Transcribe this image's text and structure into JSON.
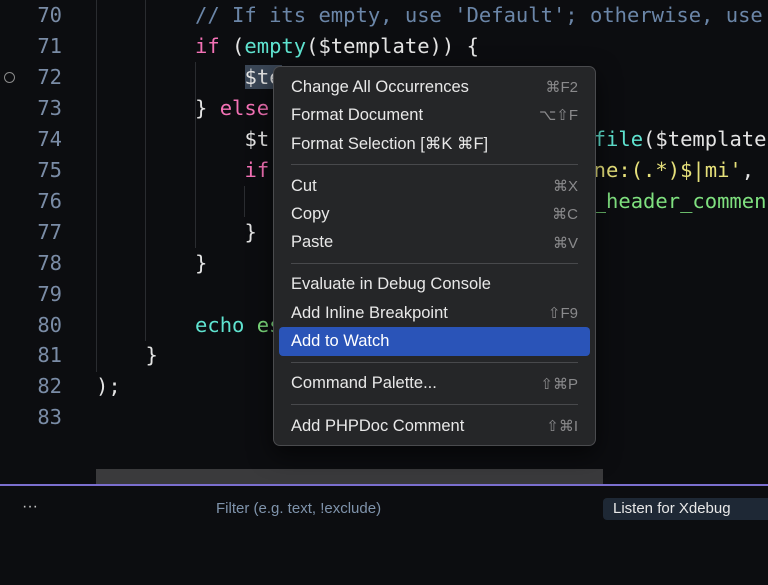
{
  "editor": {
    "lines": [
      {
        "n": "70",
        "indent": 8,
        "segs": [
          {
            "t": "// If its empty, use 'Default'; otherwise, use",
            "c": "comment"
          }
        ]
      },
      {
        "n": "71",
        "indent": 8,
        "segs": [
          {
            "t": "if",
            "c": "kw"
          },
          {
            "t": " (",
            "c": "var"
          },
          {
            "t": "empty",
            "c": "fn"
          },
          {
            "t": "($template)) {",
            "c": "var"
          }
        ]
      },
      {
        "n": "72",
        "indent": 12,
        "breakpoint": true,
        "segs": [
          {
            "t": "$te",
            "c": "var",
            "sel": true
          }
        ]
      },
      {
        "n": "73",
        "indent": 8,
        "segs": [
          {
            "t": "} ",
            "c": "var"
          },
          {
            "t": "else",
            "c": "kw"
          }
        ]
      },
      {
        "n": "74",
        "indent": 12,
        "segs": [
          {
            "t": "$t",
            "c": "var"
          }
        ],
        "right": [
          {
            "t": "file",
            "c": "fn"
          },
          {
            "t": "($template)",
            "c": "var"
          }
        ]
      },
      {
        "n": "75",
        "indent": 12,
        "segs": [
          {
            "t": "if",
            "c": "kw"
          }
        ],
        "right": [
          {
            "t": "ne:(.*)$|mi'",
            "c": "str"
          },
          {
            "t": ", $",
            "c": "var"
          }
        ]
      },
      {
        "n": "76",
        "indent": 16,
        "segs": [],
        "right": [
          {
            "t": "_header_commen",
            "c": "grn"
          }
        ]
      },
      {
        "n": "77",
        "indent": 12,
        "segs": [
          {
            "t": "}",
            "c": "var"
          }
        ]
      },
      {
        "n": "78",
        "indent": 8,
        "segs": [
          {
            "t": "}",
            "c": "var"
          }
        ]
      },
      {
        "n": "79",
        "indent": 0,
        "segs": []
      },
      {
        "n": "80",
        "indent": 8,
        "segs": [
          {
            "t": "echo",
            "c": "fn"
          },
          {
            "t": " es",
            "c": "grn"
          }
        ]
      },
      {
        "n": "81",
        "indent": 4,
        "segs": [
          {
            "t": "}",
            "c": "var"
          }
        ]
      },
      {
        "n": "82",
        "indent": 0,
        "segs": [
          {
            "t": ");",
            "c": "var"
          }
        ]
      },
      {
        "n": "83",
        "indent": 0,
        "segs": []
      }
    ]
  },
  "context_menu": {
    "groups": [
      [
        {
          "label": "Change All Occurrences",
          "key": "⌘F2"
        },
        {
          "label": "Format Document",
          "key": "⌥⇧F"
        },
        {
          "label": "Format Selection [⌘K ⌘F]",
          "key": ""
        }
      ],
      [
        {
          "label": "Cut",
          "key": "⌘X"
        },
        {
          "label": "Copy",
          "key": "⌘C"
        },
        {
          "label": "Paste",
          "key": "⌘V"
        }
      ],
      [
        {
          "label": "Evaluate in Debug Console",
          "key": ""
        },
        {
          "label": "Add Inline Breakpoint",
          "key": "⇧F9"
        },
        {
          "label": "Add to Watch",
          "key": "",
          "active": true
        }
      ],
      [
        {
          "label": "Command Palette...",
          "key": "⇧⌘P"
        }
      ],
      [
        {
          "label": "Add PHPDoc Comment",
          "key": "⇧⌘I"
        }
      ]
    ]
  },
  "panel": {
    "more": "···",
    "filter_placeholder": "Filter (e.g. text, !exclude)",
    "config": "Listen for Xdebug"
  },
  "colors": {
    "accent": "#2a54b8",
    "divider": "#7b6fcf"
  }
}
